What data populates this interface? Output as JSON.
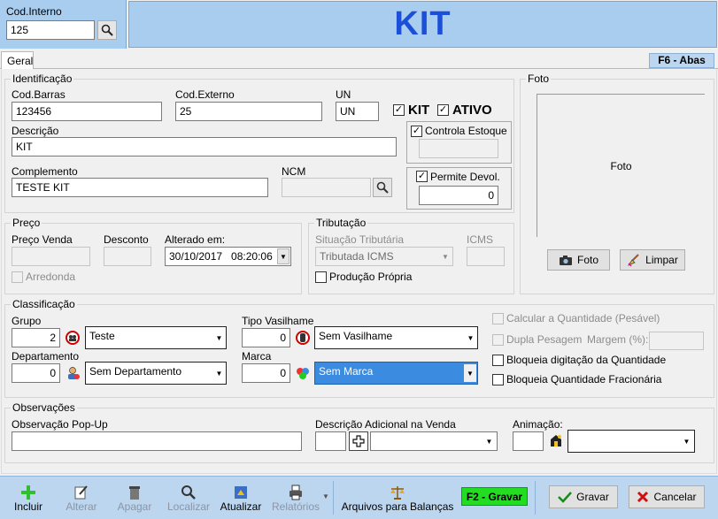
{
  "header": {
    "cod_interno_label": "Cod.Interno",
    "cod_interno_value": "125",
    "title": "KIT"
  },
  "tabs": {
    "active": "Geral",
    "shortcut": "F6 - Abas"
  },
  "identificacao": {
    "title": "Identificação",
    "cod_barras_label": "Cod.Barras",
    "cod_barras_value": "123456",
    "cod_externo_label": "Cod.Externo",
    "cod_externo_value": "25",
    "un_label": "UN",
    "un_value": "UN",
    "kit_label": "KIT",
    "kit_checked": true,
    "ativo_label": "ATIVO",
    "ativo_checked": true,
    "descricao_label": "Descrição",
    "descricao_value": "KIT",
    "controla_estoque_label": "Controla Estoque",
    "complemento_label": "Complemento",
    "complemento_value": "TESTE KIT",
    "ncm_label": "NCM",
    "ncm_value": "",
    "permite_devol_label": "Permite Devol.",
    "permite_devol_value": "0"
  },
  "foto": {
    "title": "Foto",
    "placeholder": "Foto",
    "foto_button": "Foto",
    "limpar_button": "Limpar"
  },
  "preco": {
    "title": "Preço",
    "preco_venda_label": "Preço Venda",
    "desconto_label": "Desconto",
    "alterado_label": "Alterado em:",
    "alterado_value": "30/10/2017   08:20:06",
    "arredonda_label": "Arredonda"
  },
  "tributacao": {
    "title": "Tributação",
    "situacao_label": "Situação Tributária",
    "situacao_value": "Tributada ICMS",
    "icms_label": "ICMS",
    "producao_propria_label": "Produção Própria"
  },
  "classificacao": {
    "title": "Classificação",
    "grupo_label": "Grupo",
    "grupo_code": "2",
    "grupo_value": "Teste",
    "tipo_vasilhame_label": "Tipo Vasilhame",
    "tipo_vasilhame_code": "0",
    "tipo_vasilhame_value": "Sem Vasilhame",
    "departamento_label": "Departamento",
    "departamento_code": "0",
    "departamento_value": "Sem Departamento",
    "marca_label": "Marca",
    "marca_code": "0",
    "marca_value": "Sem Marca",
    "calcular_quantidade_label": "Calcular a Quantidade (Pesável)",
    "dupla_pesagem_label": "Dupla Pesagem",
    "margem_label": "Margem (%):",
    "bloqueia_digitacao_label": "Bloqueia digitação da Quantidade",
    "bloqueia_fracionaria_label": "Bloqueia Quantidade Fracionária"
  },
  "observacoes": {
    "title": "Observações",
    "popup_label": "Observação Pop-Up",
    "descricao_adicional_label": "Descrição Adicional na Venda",
    "animacao_label": "Animação:"
  },
  "toolbar": {
    "incluir": "Incluir",
    "alterar": "Alterar",
    "apagar": "Apagar",
    "localizar": "Localizar",
    "atualizar": "Atualizar",
    "relatorios": "Relatórios",
    "arquivos_balancas": "Arquivos para Balanças",
    "f2_gravar": "F2 - Gravar",
    "gravar": "Gravar",
    "cancelar": "Cancelar"
  },
  "colors": {
    "title_blue": "#1c4fd8",
    "header_bg": "#a9cdef",
    "toolbar_bg": "#bcd6f0",
    "f2_green": "#22dd22",
    "selection_blue": "#3b8be0"
  }
}
